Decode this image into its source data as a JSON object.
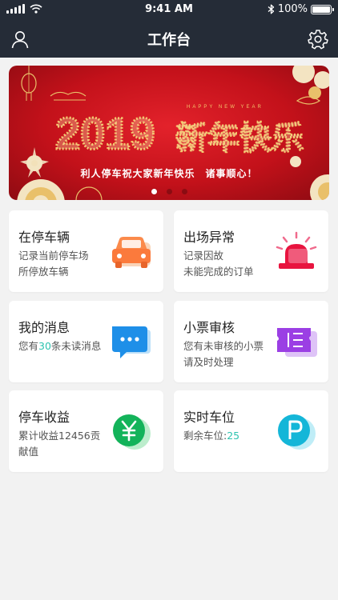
{
  "status_bar": {
    "time": "9:41 AM",
    "battery": "100%"
  },
  "header": {
    "title": "工作台"
  },
  "banner": {
    "year": "2019",
    "greeting": "新年快乐",
    "happy_new_year": "HAPPY NEW YEAR",
    "headline": "利人停车祝大家新年快乐　诸事顺心！",
    "slides": 3,
    "active_slide": 1
  },
  "cards": [
    {
      "title": "在停车辆",
      "desc_lines": [
        "记录当前停车场",
        "所停放车辆"
      ],
      "icon": "car-icon"
    },
    {
      "title": "出场异常",
      "desc_lines": [
        "记录因故",
        "未能完成的订单"
      ],
      "icon": "alarm-light-icon"
    },
    {
      "title": "我的消息",
      "desc_prefix": "您有",
      "desc_value": "30",
      "desc_suffix": "条未读消息",
      "icon": "message-icon"
    },
    {
      "title": "小票审核",
      "desc_lines": [
        "您有未审核的小票",
        "请及时处理"
      ],
      "icon": "ticket-icon"
    },
    {
      "title": "停车收益",
      "desc_lines": [
        "累计收益12456贡",
        "献值"
      ],
      "icon": "yuan-icon"
    },
    {
      "title": "实时车位",
      "desc_prefix": "剩余车位:",
      "desc_value": "25",
      "desc_suffix": "",
      "icon": "parking-icon"
    }
  ],
  "colors": {
    "header_bg": "#252c37",
    "accent": "#2ec3b0",
    "banner_red": "#d21a23"
  }
}
